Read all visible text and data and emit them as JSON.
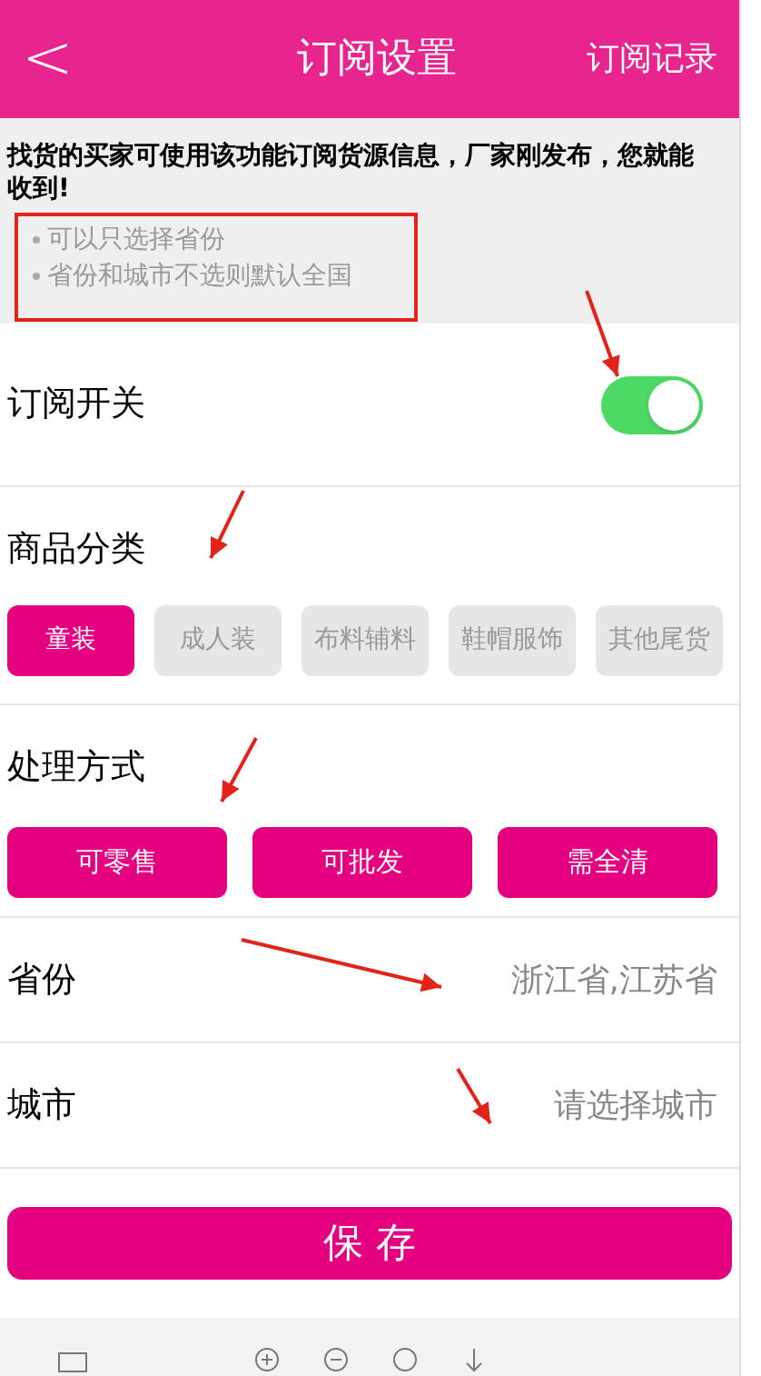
{
  "header": {
    "back": "<",
    "title": "订阅设置",
    "action": "订阅记录"
  },
  "notice": {
    "text": "找货的买家可使用该功能订阅货源信息，厂家刚发布，您就能收到!",
    "tips": [
      "可以只选择省份",
      "省份和城市不选则默认全国"
    ]
  },
  "subscribe_switch": {
    "label": "订阅开关",
    "on": true
  },
  "category": {
    "label": "商品分类",
    "options": [
      {
        "label": "童装",
        "selected": true
      },
      {
        "label": "成人装",
        "selected": false
      },
      {
        "label": "布料辅料",
        "selected": false
      },
      {
        "label": "鞋帽服饰",
        "selected": false
      },
      {
        "label": "其他尾货",
        "selected": false
      }
    ]
  },
  "handling": {
    "label": "处理方式",
    "options": [
      {
        "label": "可零售",
        "selected": true
      },
      {
        "label": "可批发",
        "selected": true
      },
      {
        "label": "需全清",
        "selected": true
      }
    ]
  },
  "fields": [
    {
      "label": "省份",
      "value": "浙江省,江苏省"
    },
    {
      "label": "城市",
      "placeholder": "请选择城市"
    }
  ],
  "save": "保 存"
}
